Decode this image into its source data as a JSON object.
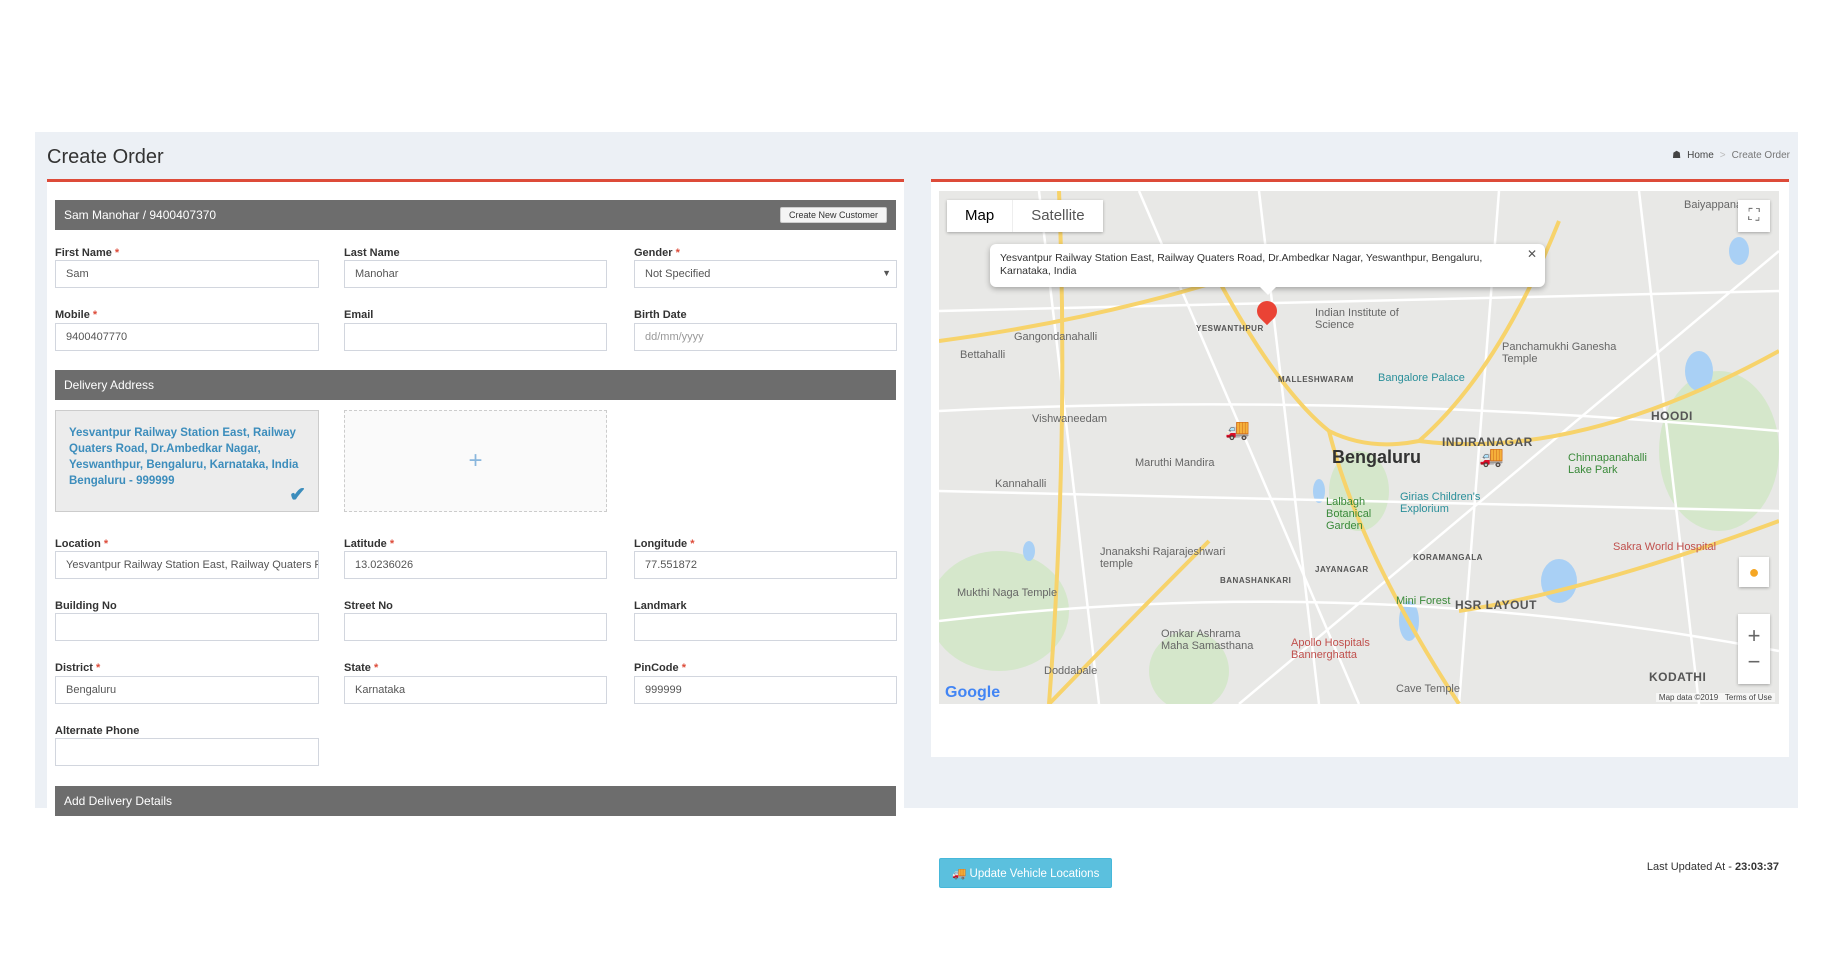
{
  "page": {
    "title": "Create Order",
    "breadcrumb": {
      "home": "Home",
      "current": "Create Order"
    }
  },
  "customer": {
    "header": "Sam Manohar / 9400407370",
    "create_new_label": "Create New Customer",
    "first_name": {
      "label": "First Name",
      "value": "Sam"
    },
    "last_name": {
      "label": "Last Name",
      "value": "Manohar"
    },
    "gender": {
      "label": "Gender",
      "value": "Not Specified"
    },
    "mobile": {
      "label": "Mobile",
      "value": "9400407770"
    },
    "email": {
      "label": "Email",
      "value": ""
    },
    "birth_date": {
      "label": "Birth Date",
      "placeholder": "dd/mm/yyyy"
    }
  },
  "delivery": {
    "header": "Delivery Address",
    "selected_address": "Yesvantpur Railway Station East, Railway Quaters Road, Dr.Ambedkar Nagar, Yeswanthpur, Bengaluru, Karnataka, India Bengaluru - 999999",
    "add_label": "+",
    "location": {
      "label": "Location",
      "value": "Yesvantpur Railway Station East, Railway Quaters Road"
    },
    "latitude": {
      "label": "Latitude",
      "value": "13.0236026"
    },
    "longitude": {
      "label": "Longitude",
      "value": "77.551872"
    },
    "building_no": {
      "label": "Building No",
      "value": ""
    },
    "street_no": {
      "label": "Street No",
      "value": ""
    },
    "landmark": {
      "label": "Landmark",
      "value": ""
    },
    "district": {
      "label": "District",
      "value": "Bengaluru"
    },
    "state": {
      "label": "State",
      "value": "Karnataka"
    },
    "pincode": {
      "label": "PinCode",
      "value": "999999"
    },
    "alternate_phone": {
      "label": "Alternate Phone",
      "value": ""
    }
  },
  "add_delivery_details": "Add Delivery Details",
  "map": {
    "tabs": [
      "Map",
      "Satellite"
    ],
    "active_tab": "Map",
    "popup": "Yesvantpur Railway Station East, Railway Quaters Road, Dr.Ambedkar Nagar, Yeswanthpur, Bengaluru, Karnataka, India",
    "attribution": "Map data ©2019",
    "terms": "Terms of Use",
    "logo": "Google",
    "labels": {
      "bengaluru": "Bengaluru",
      "indiranagar": "INDIRANAGAR",
      "hoodi": "HOODI",
      "hsr": "HSR LAYOUT",
      "kodathi": "KODATHI",
      "yeswanthpur": "YESWANTHPUR",
      "iisc": "Indian Institute of Science",
      "gangondanahalli": "Gangondanahalli",
      "bettahalli": "Bettahalli",
      "malleshwaram": "MALLESHWARAM",
      "palace": "Bangalore Palace",
      "panchamukhi": "Panchamukhi Ganesha Temple",
      "vishwaneedam": "Vishwaneedam",
      "maruthi": "Maruthi Mandira",
      "lalbagh": "Lalbagh Botanical Garden",
      "girias": "Girias Children's Explorium",
      "jayanagar": "JAYANAGAR",
      "koramangala": "KORAMANGALA",
      "banashankari": "BANASHANKARI",
      "miniforest": "Mini Forest",
      "apollo": "Apollo Hospitals Bannerghatta",
      "sakra": "Sakra World Hospital",
      "rajarajeshwari": "Jnanakshi Rajarajeshwari temple",
      "mukthi": "Mukthi Naga Temple",
      "omkar": "Omkar Ashrama Maha Samasthana",
      "doddabale": "Doddabale",
      "cave": "Cave Temple",
      "kannahalli": "Kannahalli",
      "lakepark": "Chinnapanahalli Lake Park",
      "baiyappanahalli": "Baiyappanahalli"
    }
  },
  "update_button": "Update Vehicle Locations",
  "last_updated": {
    "label": "Last Updated At - ",
    "time": "23:03:37"
  },
  "colors": {
    "accent": "#dd4b39",
    "link": "#3c8dbc",
    "info": "#5bc0de",
    "bar": "#6d6d6d"
  }
}
